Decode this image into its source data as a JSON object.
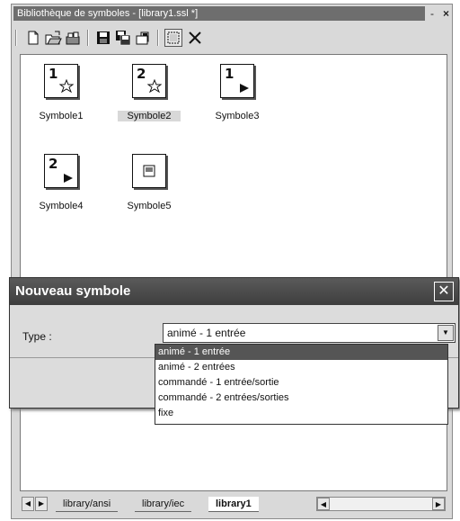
{
  "panel": {
    "title": "Bibliothèque de symboles - [library1.ssl *]",
    "minimize_glyph": "-",
    "close_glyph": "×"
  },
  "toolbar": {
    "icons": [
      "new-file-icon",
      "open-folder-icon",
      "open-library-icon",
      "save-icon",
      "save-all-icon",
      "properties-icon",
      "select-frame-icon",
      "delete-icon"
    ]
  },
  "symbols": [
    {
      "label": "Symbole1",
      "number": "1",
      "kind": "star"
    },
    {
      "label": "Symbole2",
      "number": "2",
      "kind": "star"
    },
    {
      "label": "Symbole3",
      "number": "1",
      "kind": "arrow"
    },
    {
      "label": "Symbole4",
      "number": "2",
      "kind": "arrow"
    },
    {
      "label": "Symbole5",
      "number": "",
      "kind": "square"
    }
  ],
  "tabs": [
    {
      "label": "library/ansi"
    },
    {
      "label": "library/iec"
    },
    {
      "label": "library1"
    }
  ],
  "dialog": {
    "title": "Nouveau symbole",
    "type_label": "Type :",
    "selected_value": "animé - 1 entrée",
    "options": [
      "animé - 1 entrée",
      "animé - 2 entrées",
      "commandé - 1 entrée/sortie",
      "commandé - 2 entrées/sorties",
      "fixe"
    ]
  },
  "colors": {
    "panel_bg": "#d9d9d9",
    "dialog_title_bg": "#4a4a4a",
    "selected_option_bg": "#555555"
  }
}
